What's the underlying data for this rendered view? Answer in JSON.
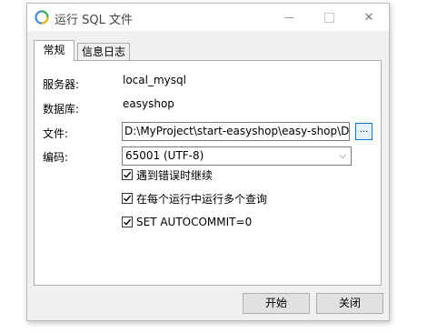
{
  "window": {
    "title": "运行 SQL 文件",
    "app_icon": "navicat-icon",
    "minimize_icon": "minimize-icon",
    "maximize_icon": "maximize-icon",
    "close_icon": "close-icon",
    "close_glyph": "✕"
  },
  "tabs": [
    {
      "label": "常规",
      "active": true
    },
    {
      "label": "信息日志",
      "active": false
    }
  ],
  "form": {
    "server_label": "服务器:",
    "server_value": "local_mysql",
    "database_label": "数据库:",
    "database_value": "easyshop",
    "file_label": "文件:",
    "file_value": "D:\\MyProject\\start-easyshop\\easy-shop\\D",
    "browse_label": "...",
    "encoding_label": "编码:",
    "encoding_value": "65001 (UTF-8)",
    "encoding_arrow": "⌵"
  },
  "options": [
    {
      "label": "遇到错误时继续",
      "checked": true
    },
    {
      "label": "在每个运行中运行多个查询",
      "checked": true
    },
    {
      "label": "SET AUTOCOMMIT=0",
      "checked": true
    }
  ],
  "buttons": {
    "start_label": "开始",
    "close_label": "关闭"
  }
}
